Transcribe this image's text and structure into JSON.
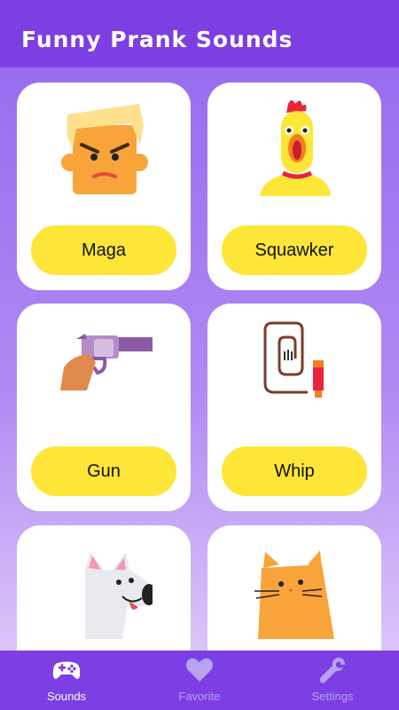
{
  "header": {
    "title": "Funny Prank Sounds"
  },
  "sounds": [
    {
      "label": "Maga",
      "icon": "angry-blond-man-icon"
    },
    {
      "label": "Squawker",
      "icon": "rubber-chicken-icon"
    },
    {
      "label": "Gun",
      "icon": "revolver-icon"
    },
    {
      "label": "Whip",
      "icon": "whip-icon"
    },
    {
      "label": "",
      "icon": "dog-icon"
    },
    {
      "label": "",
      "icon": "cat-icon"
    }
  ],
  "nav": {
    "sounds": {
      "label": "Sounds",
      "icon": "gamepad-icon",
      "active": true
    },
    "favorite": {
      "label": "Favorite",
      "icon": "heart-icon",
      "active": false
    },
    "settings": {
      "label": "Settings",
      "icon": "wrench-icon",
      "active": false
    }
  },
  "colors": {
    "header": "#7b3fe4",
    "button": "#fde637",
    "nav_active": "#ffffff",
    "nav_inactive": "#b7a3ee"
  }
}
